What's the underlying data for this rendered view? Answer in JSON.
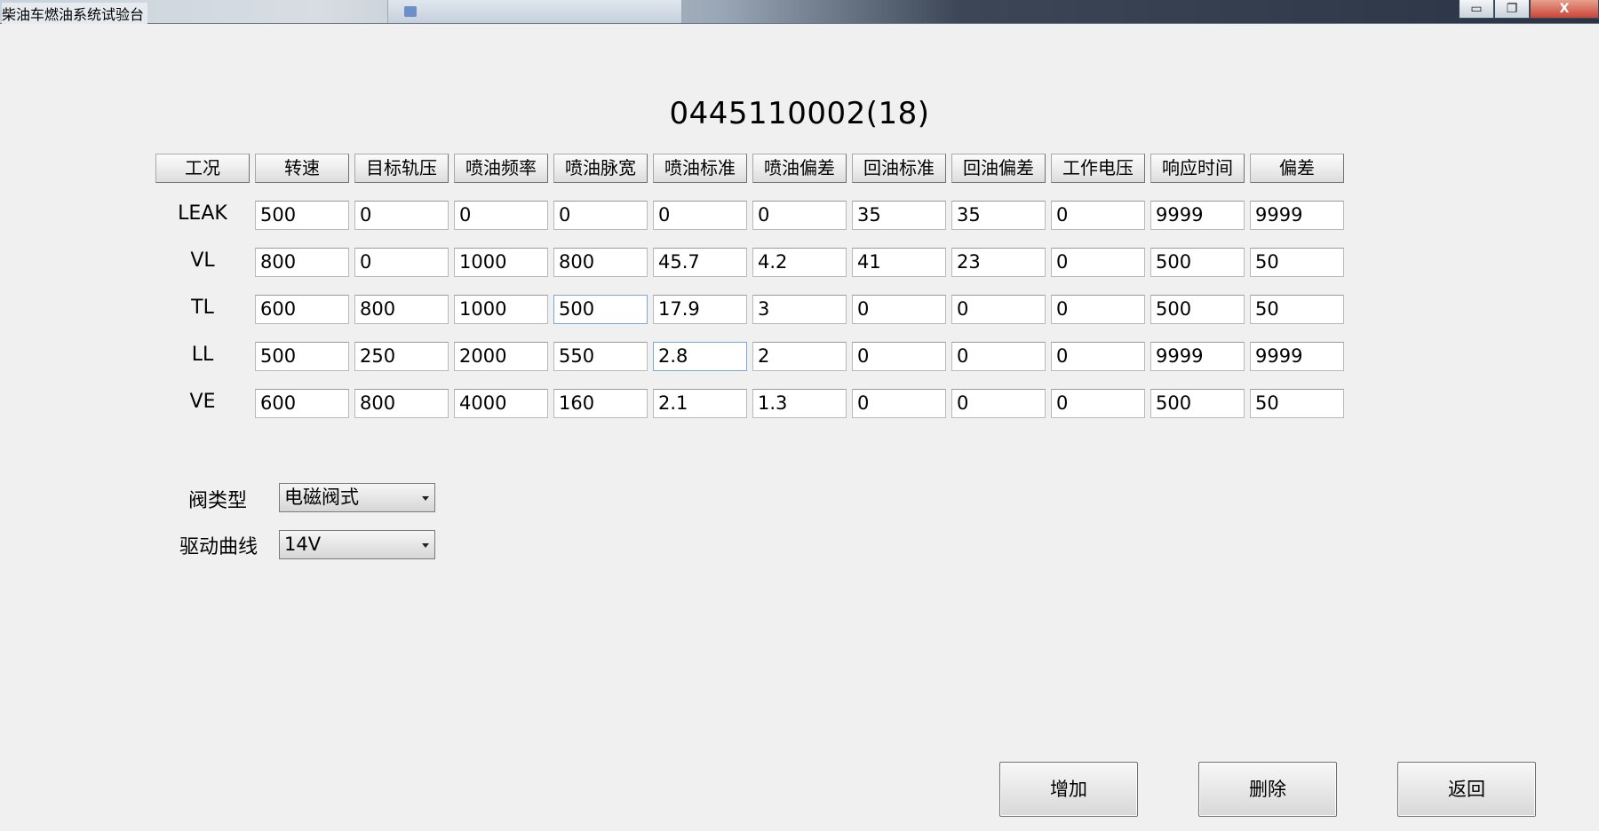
{
  "window": {
    "title": "柴油车燃油系统试验台",
    "controls": {
      "minimize": "▭",
      "restore": "❐",
      "close": "X"
    }
  },
  "page": {
    "heading": "0445110002(18)"
  },
  "table": {
    "columns": [
      "工况",
      "转速",
      "目标轨压",
      "喷油频率",
      "喷油脉宽",
      "喷油标准",
      "喷油偏差",
      "回油标准",
      "回油偏差",
      "工作电压",
      "响应时间",
      "偏差"
    ],
    "rows": [
      {
        "label": "LEAK",
        "values": [
          "500",
          "0",
          "0",
          "0",
          "0",
          "0",
          "35",
          "35",
          "0",
          "9999",
          "9999"
        ]
      },
      {
        "label": "VL",
        "values": [
          "800",
          "0",
          "1000",
          "800",
          "45.7",
          "4.2",
          "41",
          "23",
          "0",
          "500",
          "50"
        ]
      },
      {
        "label": "TL",
        "values": [
          "600",
          "800",
          "1000",
          "500",
          "17.9",
          "3",
          "0",
          "0",
          "0",
          "500",
          "50"
        ]
      },
      {
        "label": "LL",
        "values": [
          "500",
          "250",
          "2000",
          "550",
          "2.8",
          "2",
          "0",
          "0",
          "0",
          "9999",
          "9999"
        ]
      },
      {
        "label": "VE",
        "values": [
          "600",
          "800",
          "4000",
          "160",
          "2.1",
          "1.3",
          "0",
          "0",
          "0",
          "500",
          "50"
        ]
      }
    ]
  },
  "settings": {
    "valve_type": {
      "label": "阀类型",
      "value": "电磁阀式"
    },
    "drive_curve": {
      "label": "驱动曲线",
      "value": "14V"
    }
  },
  "buttons": {
    "add": "增加",
    "delete": "删除",
    "back": "返回"
  }
}
